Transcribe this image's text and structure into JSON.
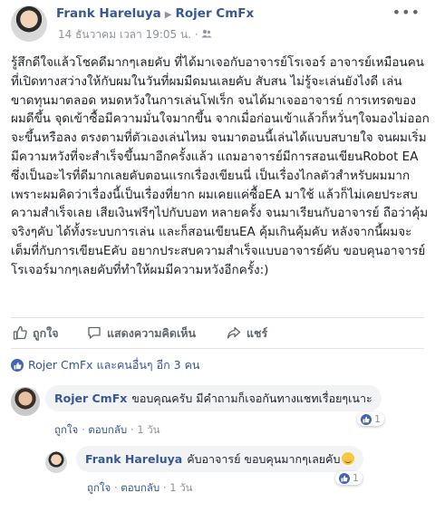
{
  "post": {
    "author": "Frank Hareluya",
    "recipient": "Rojer CmFx",
    "timestamp": "14 ธันวาคม เวลา 19:05 น.",
    "audience_icon": "friends-icon",
    "more_icon": "more-icon",
    "text": "รู้สึกดีใจแล้วโชคดีมากๆเลยคับ ที่ได้มาเจอกับอาจารย์โรเจอร์ อาจารย์เหมือนคนที่เปิดทางสว่างให้กับผมในวันที่ผมมืดมนเลยคับ สับสน ไม่รู้จะเล่นยังไงดี เล่นขาดทุนมาตลอด หมดหวังในการเล่นโฟเร็ก จนได้มาเจออาจารย์ การเทรดของผมดีขึ้น จุดเข้าซื้อมีความมั่นใจมากขึ้น จากเมื่อก่อนเข้าแล้วก็หวั่นๆใจมองไม่ออกจะขึ้นหรือลง ตรงตามที่ตัวเองเล่นไหม จนมาตอนนี้เล่นได้แบบสบายใจ จนผมเริ่มมีความหวังที่จะสำเร็จขึ้นมาอีกครั้งแล้ว แถมอาจารย์มีการสอนเขียนRobot EA ซึ่งเป็นอะไรที่ดีมากเลยคับตอนแรกเรื่องเขียนนี่ เป็นเรื่องไกลตัวสำหรับผมมาก เพราะผมคิดว่าเรื่องนี้เป็นเรื่องที่ยาก ผมเคยแค่ซื้อEA มาใช้ แล้วก็ไม่เคยประสบความสำเร็จเลย เสียเงินฟรีๆไปกับบอท หลายครั้ง จนมาเรียนกับอาจารย์ ถือว่าคุ้มจริงๆคับ ได้ทั้งระบบการเล่น และก็สอนเขียนEA คุ้มเกินคุ้มคับ หลังจากนี้ผมจะเต็มที่กับการเขียนEคับ อยากประสบความสำเร็จแบบอาจารย์คับ ขอบคุนอาจารย์โรเจอร์มากๆเลยคับที่ทำให้ผมมีความหวังอีกครั้ง:)"
  },
  "actions": {
    "like": "ถูกใจ",
    "comment": "แสดงความคิดเห็น",
    "share": "แชร์"
  },
  "likes_summary": "Rojer CmFx และคนอื่นๆ อีก 3 คน",
  "comments": [
    {
      "author": "Rojer CmFx",
      "text": "ขอบคุณครับ มีคำถามก็เจอกันทางแชทเรื่อยๆเนาะ",
      "like_label": "ถูกใจ",
      "reply_label": "ตอบกลับ",
      "time": "1 วัน",
      "reaction_count": "1"
    },
    {
      "author": "Frank Hareluya",
      "text": "คับอาจารย์ ขอบคุนมากๆเลยคับ",
      "emoji": "smiling-emoji",
      "like_label": "ถูกใจ",
      "reply_label": "ตอบกลับ",
      "time": "1 วัน",
      "reaction_count": "1"
    }
  ],
  "colors": {
    "link": "#365899",
    "meta": "#90949c",
    "bubble": "#f2f3f5",
    "like_blue": "#4267b2"
  }
}
